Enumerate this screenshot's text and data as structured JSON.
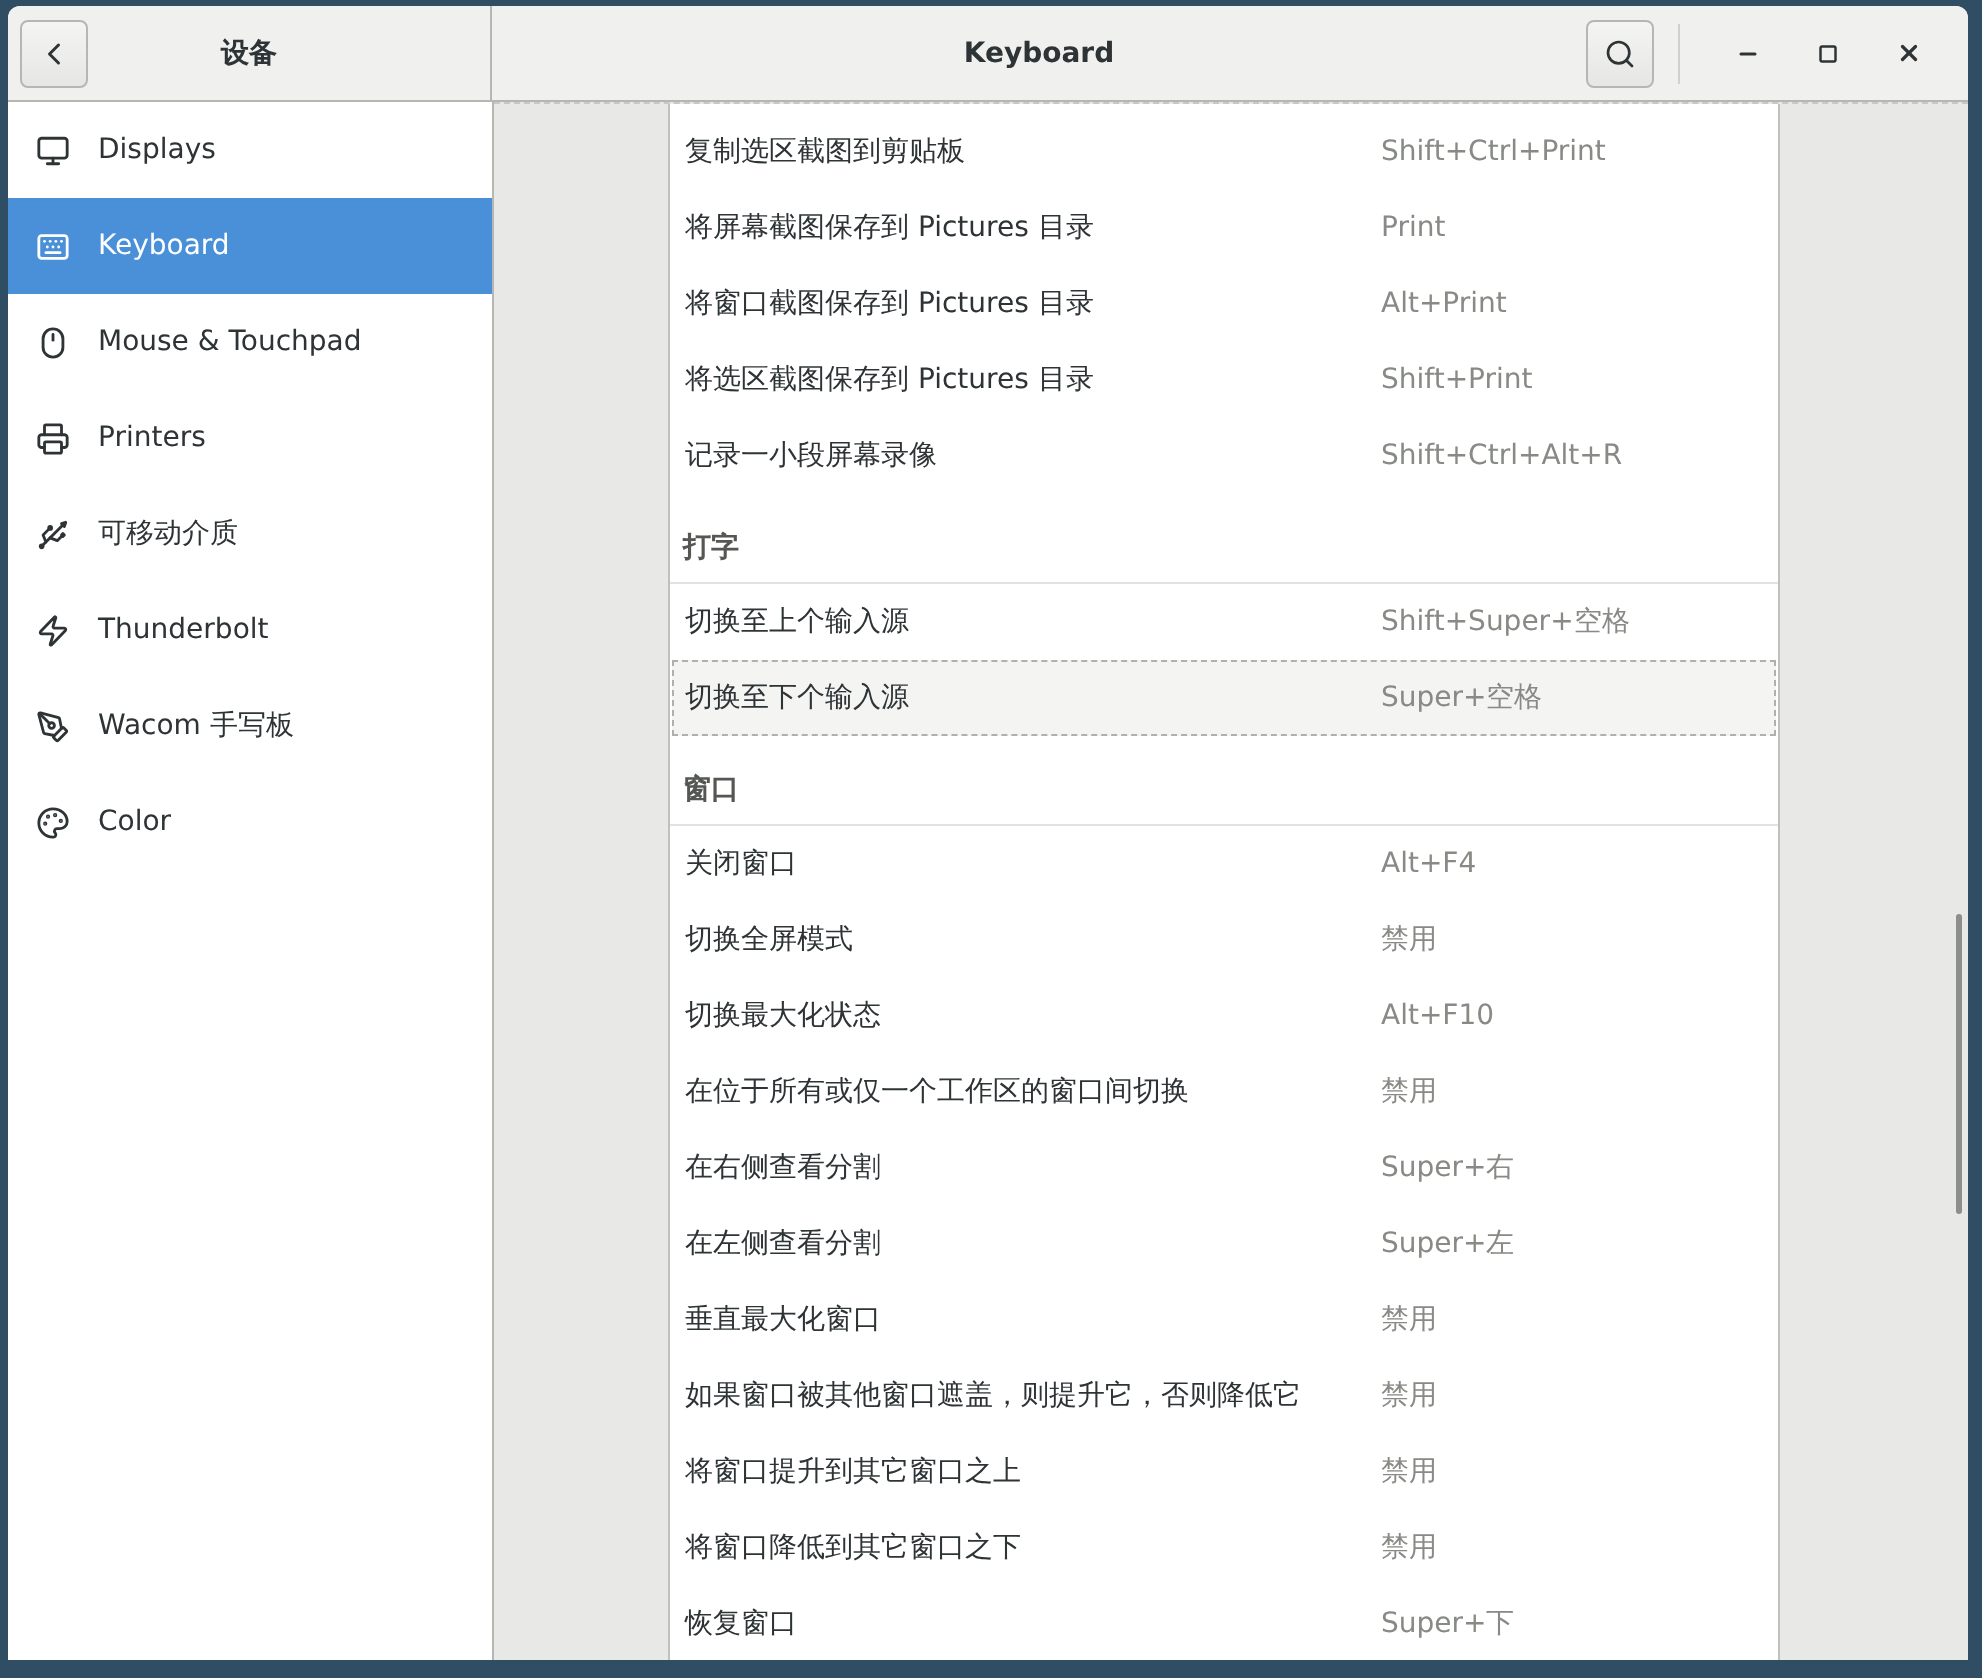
{
  "sidebar": {
    "title": "设备",
    "items": [
      {
        "label": "Displays",
        "selected": false
      },
      {
        "label": "Keyboard",
        "selected": true
      },
      {
        "label": "Mouse & Touchpad",
        "selected": false
      },
      {
        "label": "Printers",
        "selected": false
      },
      {
        "label": "可移动介质",
        "selected": false
      },
      {
        "label": "Thunderbolt",
        "selected": false
      },
      {
        "label": "Wacom 手写板",
        "selected": false
      },
      {
        "label": "Color",
        "selected": false
      }
    ]
  },
  "window": {
    "title": "Keyboard"
  },
  "sections": [
    {
      "rows": [
        {
          "action": "复制选区截图到剪贴板",
          "shortcut": "Shift+Ctrl+Print",
          "selected": false
        },
        {
          "action": "将屏幕截图保存到 Pictures 目录",
          "shortcut": "Print",
          "selected": false
        },
        {
          "action": "将窗口截图保存到 Pictures 目录",
          "shortcut": "Alt+Print",
          "selected": false
        },
        {
          "action": "将选区截图保存到 Pictures 目录",
          "shortcut": "Shift+Print",
          "selected": false
        },
        {
          "action": "记录一小段屏幕录像",
          "shortcut": "Shift+Ctrl+Alt+R",
          "selected": false
        }
      ]
    },
    {
      "title": "打字",
      "rows": [
        {
          "action": "切换至上个输入源",
          "shortcut": "Shift+Super+空格",
          "selected": false
        },
        {
          "action": "切换至下个输入源",
          "shortcut": "Super+空格",
          "selected": true
        }
      ]
    },
    {
      "title": "窗口",
      "rows": [
        {
          "action": "关闭窗口",
          "shortcut": "Alt+F4",
          "selected": false
        },
        {
          "action": "切换全屏模式",
          "shortcut": "禁用",
          "selected": false
        },
        {
          "action": "切换最大化状态",
          "shortcut": "Alt+F10",
          "selected": false
        },
        {
          "action": "在位于所有或仅一个工作区的窗口间切换",
          "shortcut": "禁用",
          "selected": false
        },
        {
          "action": "在右侧查看分割",
          "shortcut": "Super+右",
          "selected": false
        },
        {
          "action": "在左侧查看分割",
          "shortcut": "Super+左",
          "selected": false
        },
        {
          "action": "垂直最大化窗口",
          "shortcut": "禁用",
          "selected": false
        },
        {
          "action": "如果窗口被其他窗口遮盖，则提升它，否则降低它",
          "shortcut": "禁用",
          "selected": false
        },
        {
          "action": "将窗口提升到其它窗口之上",
          "shortcut": "禁用",
          "selected": false
        },
        {
          "action": "将窗口降低到其它窗口之下",
          "shortcut": "禁用",
          "selected": false
        },
        {
          "action": "恢复窗口",
          "shortcut": "Super+下",
          "selected": false
        }
      ]
    }
  ]
}
